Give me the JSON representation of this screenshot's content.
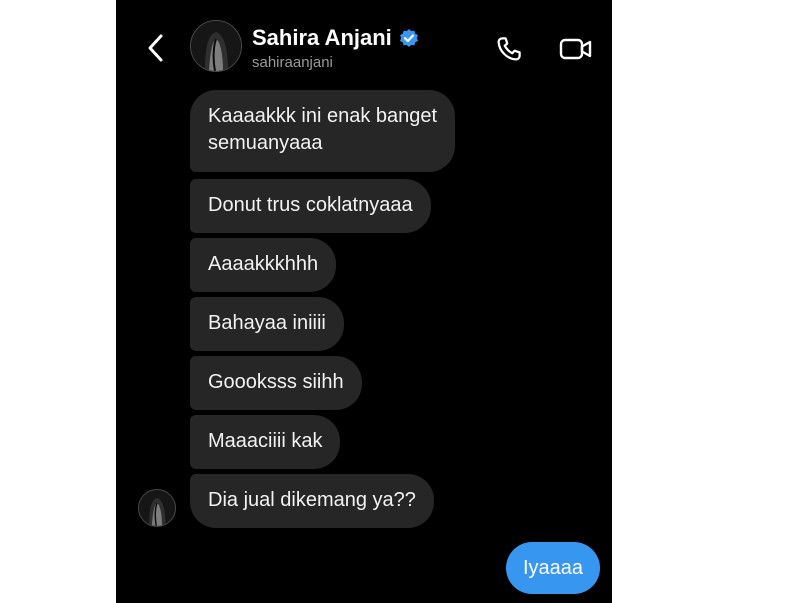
{
  "header": {
    "name": "Sahira Anjani",
    "username": "sahiraanjani",
    "back_icon": "chevron-left-icon",
    "verified_icon": "verified-badge-icon",
    "call_icon": "phone-icon",
    "video_icon": "video-camera-icon"
  },
  "messages": [
    {
      "from": "other",
      "text": "Kaaaakkk ini enak banget\nsemuanyaaa"
    },
    {
      "from": "other",
      "text": "Donut trus coklatnyaaa"
    },
    {
      "from": "other",
      "text": "Aaaakkkhhh"
    },
    {
      "from": "other",
      "text": "Bahayaa iniiii"
    },
    {
      "from": "other",
      "text": "Goooksss siihh"
    },
    {
      "from": "other",
      "text": "Maaaciiii kak"
    },
    {
      "from": "other",
      "text": "Dia jual dikemang ya??"
    },
    {
      "from": "me",
      "text": "Iyaaaa"
    }
  ],
  "colors": {
    "background": "#000000",
    "received_bubble": "#262626",
    "sent_bubble": "#3797f0",
    "verified_badge": "#3897f0",
    "muted_text": "#9a9a9a"
  }
}
